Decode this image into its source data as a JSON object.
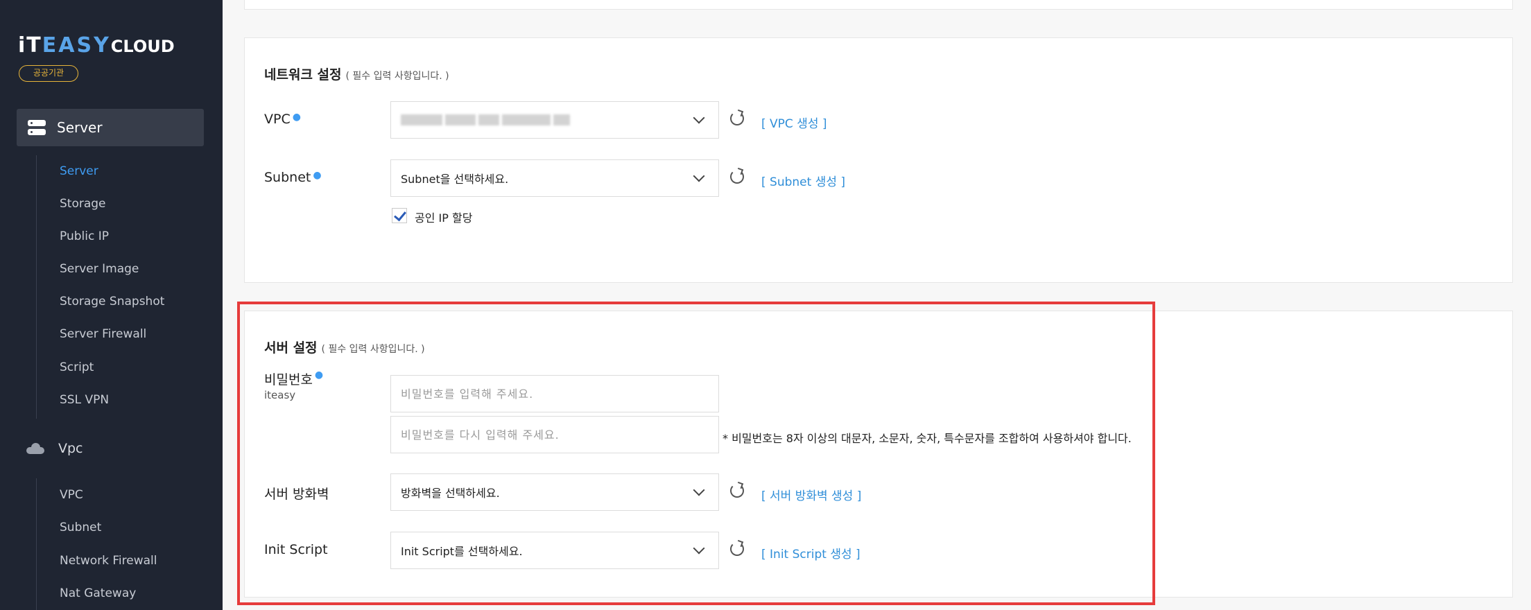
{
  "sidebar": {
    "logo": {
      "part1": "iT",
      "part2": "EASY",
      "part3": "CLOUD"
    },
    "badge": "공공기관",
    "server_menu": {
      "label": "Server",
      "icon": "server-icon"
    },
    "server_items": [
      {
        "label": "Server",
        "active": true
      },
      {
        "label": "Storage"
      },
      {
        "label": "Public IP"
      },
      {
        "label": "Server Image"
      },
      {
        "label": "Storage Snapshot"
      },
      {
        "label": "Server Firewall"
      },
      {
        "label": "Script"
      },
      {
        "label": "SSL VPN"
      }
    ],
    "vpc_menu": {
      "label": "Vpc",
      "icon": "cloud-icon"
    },
    "vpc_items": [
      {
        "label": "VPC"
      },
      {
        "label": "Subnet"
      },
      {
        "label": "Network Firewall"
      },
      {
        "label": "Nat Gateway"
      }
    ]
  },
  "network": {
    "title": "네트워크 설정",
    "note": "( 필수 입력 사항입니다. )",
    "vpc": {
      "label": "VPC",
      "link": "[ VPC 생성 ]"
    },
    "subnet": {
      "label": "Subnet",
      "value": "Subnet을 선택하세요.",
      "link": "[ Subnet 생성 ]"
    },
    "public_ip": {
      "label": "공인 IP 할당",
      "checked": true
    }
  },
  "server": {
    "title": "서버 설정",
    "note": "( 필수 입력 사항입니다. )",
    "password": {
      "label": "비밀번호",
      "sub": "iteasy",
      "placeholder1": "비밀번호를 입력해 주세요.",
      "placeholder2": "비밀번호를 다시 입력해 주세요.",
      "hint": "* 비밀번호는 8자 이상의 대문자, 소문자, 숫자, 특수문자를 조합하여 사용하셔야 합니다."
    },
    "firewall": {
      "label": "서버 방화벽",
      "value": "방화벽을 선택하세요.",
      "link": "[ 서버 방화벽 생성 ]"
    },
    "init_script": {
      "label": "Init Script",
      "value": "Init Script를 선택하세요.",
      "link": "[ Init Script 생성 ]"
    }
  },
  "colors": {
    "accent": "#3f9cf2",
    "link": "#2f8ed8",
    "highlight": "#e63c3c",
    "sidebar": "#1f2532"
  }
}
